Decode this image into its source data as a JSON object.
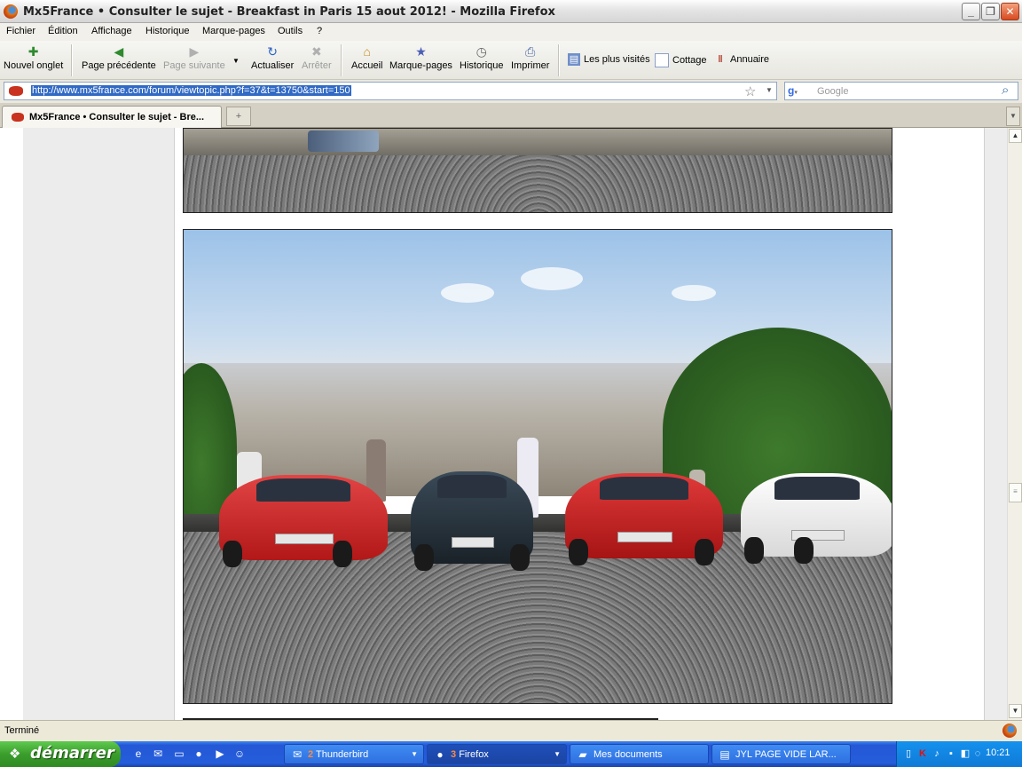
{
  "window": {
    "title": "Mx5France • Consulter le sujet - Breakfast in Paris 15 aout 2012! - Mozilla Firefox",
    "minimize_glyph": "_",
    "restore_glyph": "❐",
    "close_glyph": "✕"
  },
  "menu": {
    "items": [
      {
        "label": "Fichier"
      },
      {
        "label": "Édition"
      },
      {
        "label": "Affichage"
      },
      {
        "label": "Historique"
      },
      {
        "label": "Marque-pages"
      },
      {
        "label": "Outils"
      },
      {
        "label": "?"
      }
    ]
  },
  "toolbar": {
    "new_tab": "Nouvel onglet",
    "back": "Page précédente",
    "forward": "Page suivante",
    "reload": "Actualiser",
    "stop": "Arrêter",
    "home": "Accueil",
    "bookmarks": "Marque-pages",
    "history": "Historique",
    "print": "Imprimer",
    "forward_disabled": true,
    "stop_disabled": true
  },
  "bookmarks_bar": {
    "items": [
      {
        "label": "Les plus visités",
        "icon": "bookmark-folder-icon"
      },
      {
        "label": "Cottage",
        "icon": "page-icon"
      },
      {
        "label": "Annuaire",
        "icon": "bars-icon"
      }
    ]
  },
  "urlbar": {
    "url": "http://www.mx5france.com/forum/viewtopic.php?f=37&t=13750&start=150"
  },
  "search": {
    "engine": "Google",
    "placeholder": "Google"
  },
  "tabs": [
    {
      "label": "Mx5France • Consulter le sujet - Bre...",
      "active": true
    }
  ],
  "tab_new_glyph": "+",
  "status": {
    "text": "Terminé"
  },
  "taskbar": {
    "start_label": "démarrer",
    "tasks": [
      {
        "label": "Thunderbird",
        "count": "2",
        "icon": "thunderbird-icon",
        "active": false
      },
      {
        "label": "Firefox",
        "count": "3",
        "icon": "firefox-icon",
        "active": true
      },
      {
        "label": "Mes documents",
        "count": "",
        "icon": "folder-icon",
        "active": false
      },
      {
        "label": "JYL   PAGE VIDE LAR...",
        "count": "",
        "icon": "document-icon",
        "active": false
      }
    ],
    "clock": "10:21"
  },
  "colors": {
    "accent": "#316ac5",
    "taskbar": "#245edb",
    "start": "#3b9e2c"
  }
}
